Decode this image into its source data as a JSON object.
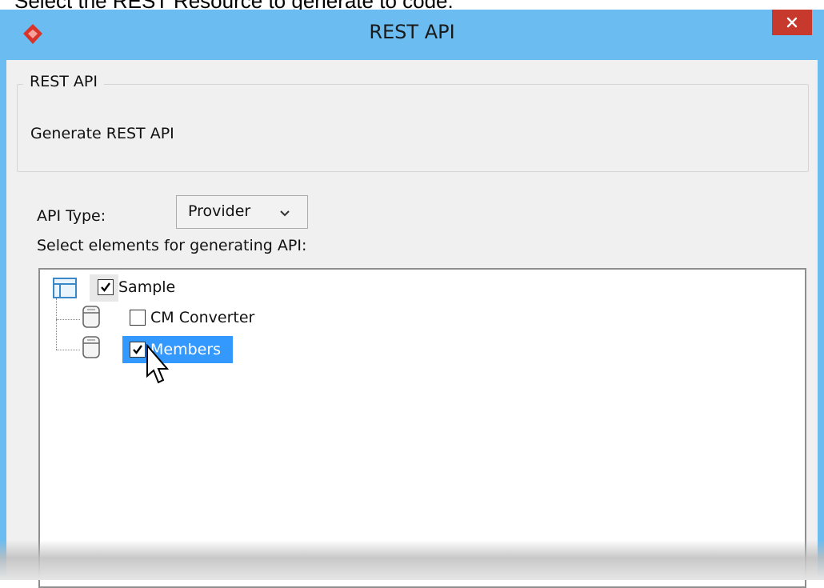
{
  "caption": "Select the REST Resource to generate to code.",
  "window": {
    "title": "REST API",
    "close_label": "×"
  },
  "group": {
    "legend": "REST API",
    "description": "Generate REST API"
  },
  "form": {
    "api_type_label": "API Type:",
    "api_type_value": "Provider",
    "select_label": "Select elements for generating API:"
  },
  "tree": {
    "root": {
      "label": "Sample",
      "checked": true
    },
    "children": [
      {
        "label": "CM Converter",
        "checked": false,
        "selected": false
      },
      {
        "label": "Members",
        "checked": true,
        "selected": true
      }
    ]
  },
  "colors": {
    "titlebar": "#6bbcf1",
    "close_button": "#c7392c",
    "selection": "#3399ff"
  }
}
